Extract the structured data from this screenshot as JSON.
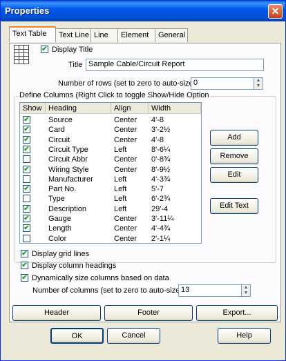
{
  "window": {
    "title": "Properties",
    "close_glyph": "✕"
  },
  "tabs": [
    "Text Table",
    "Text Line",
    "Line",
    "Element",
    "General"
  ],
  "display_title": {
    "label": "Display Title",
    "checked": true
  },
  "title_field": {
    "label": "Title",
    "value": "Sample Cable/Circuit Report"
  },
  "rows_field": {
    "label": "Number of rows (set to zero to auto-size)",
    "value": "0"
  },
  "define_columns": {
    "label": "Define Columns (Right Click to toggle Show/Hide Option",
    "headers": [
      "Show",
      "Heading",
      "Align",
      "Width"
    ],
    "rows": [
      {
        "show": true,
        "heading": "Source",
        "align": "Center",
        "width": "4'-8"
      },
      {
        "show": true,
        "heading": "Card",
        "align": "Center",
        "width": "3'-2½"
      },
      {
        "show": true,
        "heading": "Circuit",
        "align": "Center",
        "width": "4'-8"
      },
      {
        "show": true,
        "heading": "Circuit Type",
        "align": "Left",
        "width": "8'-6¼"
      },
      {
        "show": false,
        "heading": "Circuit Abbr",
        "align": "Center",
        "width": "0'-8¾"
      },
      {
        "show": true,
        "heading": "Wiring Style",
        "align": "Center",
        "width": "8'-9½"
      },
      {
        "show": false,
        "heading": "Manufacturer",
        "align": "Left",
        "width": "4'-3¾"
      },
      {
        "show": true,
        "heading": "Part No.",
        "align": "Left",
        "width": "5'-7"
      },
      {
        "show": false,
        "heading": "Type",
        "align": "Left",
        "width": "6'-2¾"
      },
      {
        "show": true,
        "heading": "Description",
        "align": "Left",
        "width": "29'-4"
      },
      {
        "show": true,
        "heading": "Gauge",
        "align": "Center",
        "width": "3'-11¼"
      },
      {
        "show": true,
        "heading": "Length",
        "align": "Center",
        "width": "4'-4¾"
      },
      {
        "show": false,
        "heading": "Color",
        "align": "Center",
        "width": "2'-1¼"
      }
    ],
    "buttons": {
      "add": "Add",
      "remove": "Remove",
      "edit": "Edit",
      "edit_text": "Edit Text"
    }
  },
  "options": {
    "grid_lines": {
      "label": "Display grid lines",
      "checked": true
    },
    "column_headings": {
      "label": "Display column headings",
      "checked": true
    },
    "dynamic_size": {
      "label": "Dynamically size columns based on data",
      "checked": true
    }
  },
  "columns_field": {
    "label": "Number of columns (set to zero to auto-size)",
    "value": "13"
  },
  "panel_buttons": {
    "header": "Header",
    "footer": "Footer",
    "export": "Export..."
  },
  "dialog_buttons": {
    "ok": "OK",
    "cancel": "Cancel",
    "help": "Help"
  },
  "check_glyph": "✔",
  "spin_glyphs": {
    "up": "▲",
    "down": "▼"
  },
  "colors": {
    "titlebar": "#0058e6",
    "tab_highlight": "#e68b2c",
    "check": "#21a121"
  }
}
